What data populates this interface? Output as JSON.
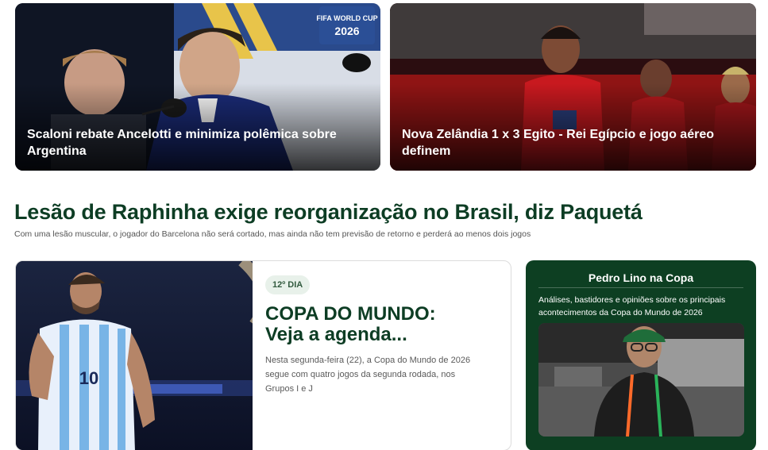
{
  "top_cards": [
    {
      "caption": "Scaloni rebate Ancelotti e minimiza polêmica sobre Argentina",
      "image_text": "FIFA WORLD CUP 2026"
    },
    {
      "caption": "Nova Zelândia 1 x 3 Egito - Rei Egípcio e jogo aéreo definem"
    }
  ],
  "headline": {
    "title": "Lesão de Raphinha exige reorganização no Brasil, diz Paquetá",
    "subtitle": "Com uma lesão muscular, o jogador do Barcelona não será cortado, mas ainda não tem previsão de retorno e perderá ao menos dois jogos"
  },
  "copa_card": {
    "badge": "12º DIA",
    "title": "COPA DO MUNDO: Veja a agenda...",
    "description": "Nesta segunda-feira (22), a Copa do Mundo de 2026 segue com quatro jogos da segunda rodada, nos Grupos I e J",
    "jersey_number": "10"
  },
  "pedro_card": {
    "title": "Pedro Lino na Copa",
    "description": "Análises, bastidores e opiniões sobre os principais acontecimentos da Copa do Mundo de 2026"
  },
  "colors": {
    "heading_green": "#0d3d24",
    "panel_green": "#0d3f22",
    "badge_bg": "#e8f1ea"
  }
}
